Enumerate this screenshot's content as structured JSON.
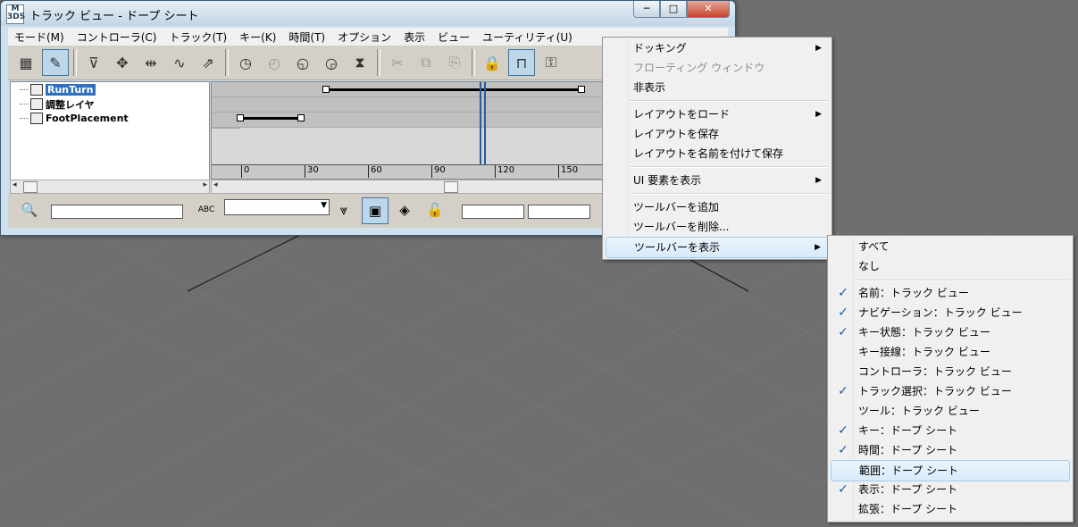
{
  "window": {
    "title": "トラック ビュー - ドープ シート",
    "app_icon_text": "M\n3DS",
    "minimize_glyph": "─",
    "maximize_glyph": "□",
    "close_glyph": "✕"
  },
  "menubar": [
    "モード(M)",
    "コントローラ(C)",
    "トラック(T)",
    "キー(K)",
    "時間(T)",
    "オプション",
    "表示",
    "ビュー",
    "ユーティリティ(U)"
  ],
  "tree": {
    "items": [
      {
        "label": "RunTurn",
        "selected": true
      },
      {
        "label": "調整レイヤ",
        "selected": false
      },
      {
        "label": "FootPlacement",
        "selected": false
      }
    ]
  },
  "ruler": {
    "ticks": [
      "0",
      "30",
      "60",
      "90",
      "120",
      "150"
    ]
  },
  "context_menu": {
    "items": [
      {
        "label": "ドッキング",
        "submenu": true,
        "disabled": false
      },
      {
        "label": "フローティング ウィンドウ",
        "submenu": false,
        "disabled": true
      },
      {
        "label": "非表示",
        "submenu": false,
        "disabled": false
      },
      {
        "label": "レイアウトをロード",
        "submenu": true,
        "disabled": false
      },
      {
        "label": "レイアウトを保存",
        "submenu": false,
        "disabled": false
      },
      {
        "label": "レイアウトを名前を付けて保存",
        "submenu": false,
        "disabled": false
      },
      {
        "label": "UI 要素を表示",
        "submenu": true,
        "disabled": false
      },
      {
        "label": "ツールバーを追加",
        "submenu": false,
        "disabled": false
      },
      {
        "label": "ツールバーを削除...",
        "submenu": false,
        "disabled": false
      },
      {
        "label": "ツールバーを表示",
        "submenu": true,
        "disabled": false,
        "highlighted": true
      }
    ],
    "arrow_glyph": "▶"
  },
  "submenu": {
    "items": [
      {
        "label": "すべて",
        "checked": false
      },
      {
        "label": "なし",
        "checked": false
      },
      {
        "label": "名前：トラック ビュー",
        "checked": true
      },
      {
        "label": "ナビゲーション：トラック ビュー",
        "checked": true
      },
      {
        "label": "キー状態：トラック ビュー",
        "checked": true
      },
      {
        "label": "キー接線：トラック ビュー",
        "checked": false
      },
      {
        "label": "コントローラ：トラック ビュー",
        "checked": false
      },
      {
        "label": "トラック選択：トラック ビュー",
        "checked": true
      },
      {
        "label": "ツール：トラック ビュー",
        "checked": false
      },
      {
        "label": "キー：ドープ シート",
        "checked": true
      },
      {
        "label": "時間：ドープ シート",
        "checked": true
      },
      {
        "label": "範囲：ドープ シート",
        "checked": false,
        "highlighted": true
      },
      {
        "label": "表示：ドープ シート",
        "checked": true
      },
      {
        "label": "拡張：ドープ シート",
        "checked": false
      }
    ],
    "check_glyph": "✓"
  },
  "statusbar": {
    "abc_label": "ABC",
    "dropdown_arrow": "▼"
  },
  "colors": {
    "viewport_bg": "#6f6f6f",
    "selection": "#2f6fbf",
    "time_line": "#1f5fa8",
    "check": "#1a5ea8"
  }
}
